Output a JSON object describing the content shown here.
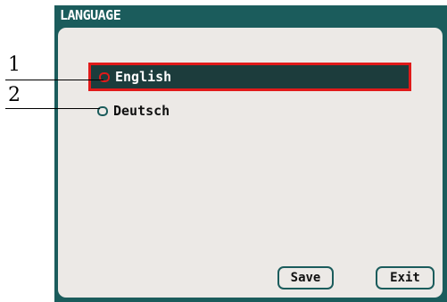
{
  "window": {
    "title": "LANGUAGE"
  },
  "options": [
    {
      "label": "English",
      "selected": true
    },
    {
      "label": "Deutsch",
      "selected": false
    }
  ],
  "buttons": {
    "save": "Save",
    "exit": "Exit"
  },
  "callouts": {
    "one": "1",
    "two": "2"
  },
  "colors": {
    "frame": "#1b5c5c",
    "panel": "#ece9e6",
    "selection": "#1c3c3c",
    "highlight": "#e01a1a"
  }
}
